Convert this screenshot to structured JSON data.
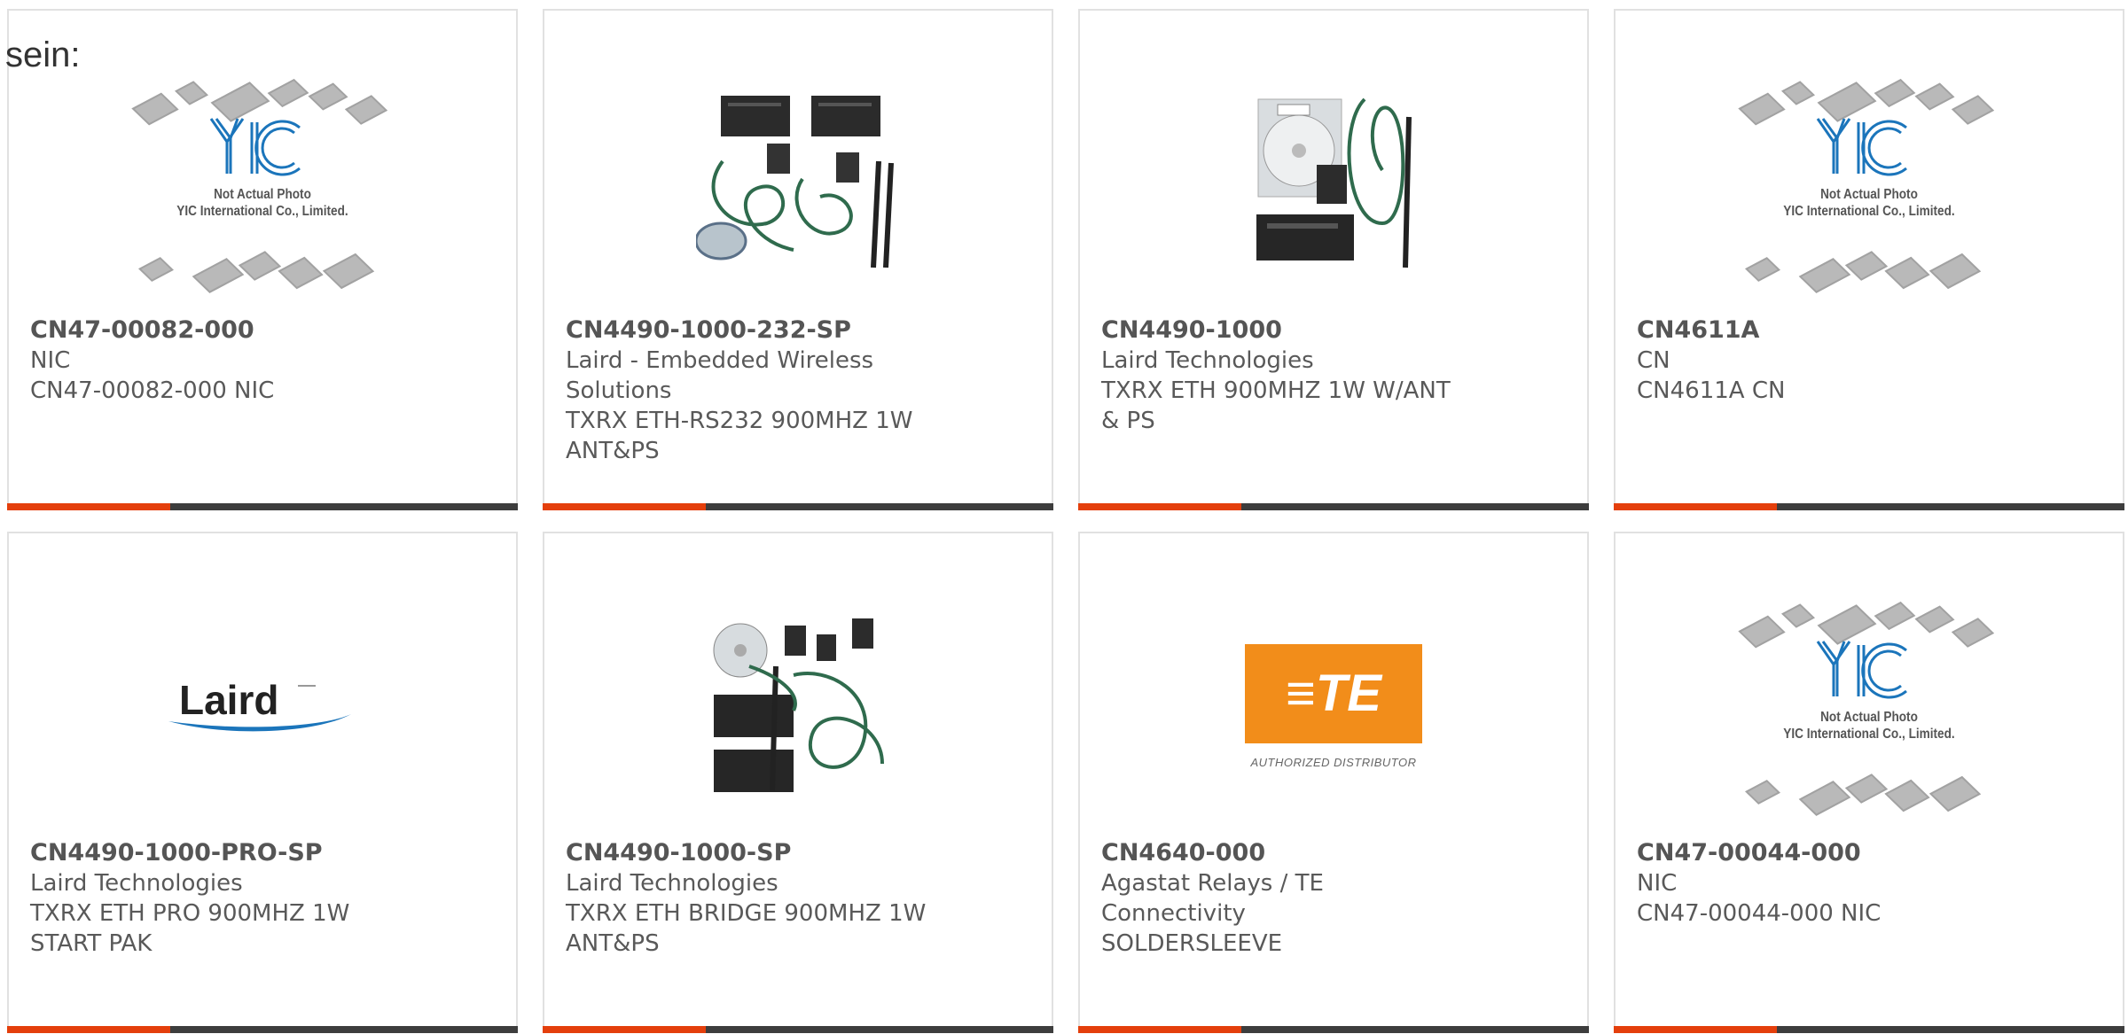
{
  "lead_text": "sein:",
  "placeholder": {
    "line1": "Not Actual Photo",
    "line2": "YIC International Co., Limited."
  },
  "te_logo": {
    "caption": "AUTHORIZED DISTRIBUTOR"
  },
  "products": [
    {
      "part": "CN47-00082-000",
      "maker": "NIC",
      "desc": "CN47-00082-000 NIC",
      "image": "yic-placeholder"
    },
    {
      "part": "CN4490-1000-232-SP",
      "maker": "Laird - Embedded Wireless Solutions",
      "desc": "TXRX ETH-RS232 900MHZ 1W ANT&PS",
      "image": "radio-kit-photo"
    },
    {
      "part": "CN4490-1000",
      "maker": "Laird Technologies",
      "desc": "TXRX ETH 900MHZ 1W W/ANT & PS",
      "image": "radio-kit-photo"
    },
    {
      "part": "CN4611A",
      "maker": "CN",
      "desc": "CN4611A CN",
      "image": "yic-placeholder"
    },
    {
      "part": "CN4490-1000-PRO-SP",
      "maker": "Laird Technologies",
      "desc": "TXRX ETH PRO 900MHZ 1W START PAK",
      "image": "laird-logo"
    },
    {
      "part": "CN4490-1000-SP",
      "maker": "Laird Technologies",
      "desc": "TXRX ETH BRIDGE 900MHZ 1W ANT&PS",
      "image": "radio-kit-photo"
    },
    {
      "part": "CN4640-000",
      "maker": "Agastat Relays / TE Connectivity",
      "desc": "SOLDERSLEEVE",
      "image": "te-logo"
    },
    {
      "part": "CN47-00044-000",
      "maker": "NIC",
      "desc": "CN47-00044-000 NIC",
      "image": "yic-placeholder"
    }
  ],
  "colors": {
    "accent": "#e43f0c",
    "bar": "#3d3d3d",
    "border": "#e1e1e1",
    "text": "#595959",
    "te_orange": "#f28d1a",
    "laird_blue": "#1b75bb"
  }
}
